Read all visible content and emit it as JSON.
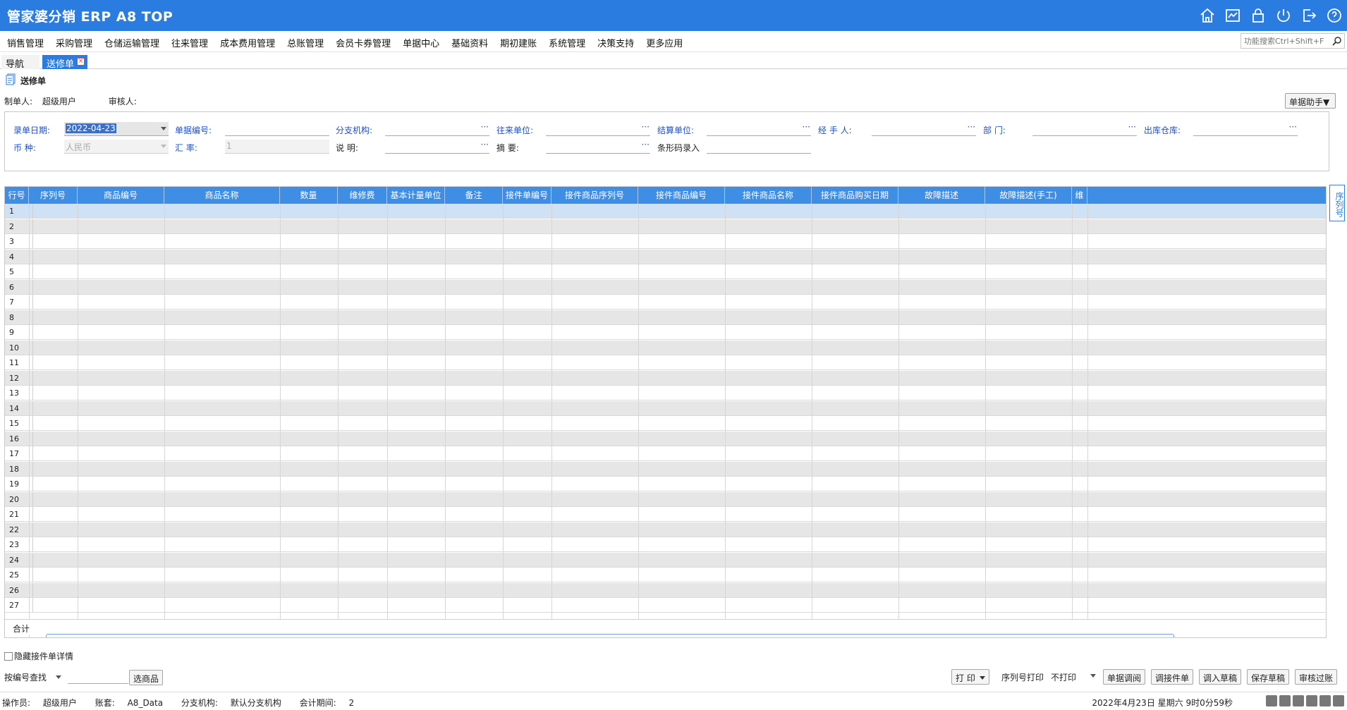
{
  "app": {
    "title": "管家婆分销 ERP A8 TOP"
  },
  "titlebar_icons": [
    "home-icon",
    "chart-icon",
    "lock-icon",
    "power-icon",
    "exit-icon",
    "help-icon"
  ],
  "menu": {
    "items": [
      "销售管理",
      "采购管理",
      "仓储运输管理",
      "往来管理",
      "成本费用管理",
      "总账管理",
      "会员卡券管理",
      "单据中心",
      "基础资料",
      "期初建账",
      "系统管理",
      "决策支持",
      "更多应用"
    ],
    "search_placeholder": "功能搜索Ctrl+Shift+F"
  },
  "tabs": {
    "nav": "导航",
    "active": "送修单"
  },
  "page": {
    "title": "送修单",
    "maker_label": "制单人:",
    "maker_value": "超级用户",
    "reviewer_label": "审核人:",
    "helper_button": "单据助手▼"
  },
  "form": {
    "date_label": "录单日期:",
    "date_value": "2022-04-23",
    "docno_label": "单据编号:",
    "branch_label": "分支机构:",
    "partner_label": "往来单位:",
    "settle_label": "结算单位:",
    "handler_label": "经 手 人:",
    "dept_label": "部    门:",
    "warehouse_label": "出库仓库:",
    "currency_label": "币    种:",
    "currency_value": "人民币",
    "rate_label": "汇    率:",
    "rate_value": "1",
    "note_label": "说    明:",
    "summary_label": "摘    要:",
    "barcode_label": "条形码录入"
  },
  "grid": {
    "columns": [
      "行号",
      "序列号",
      "商品编号",
      "商品名称",
      "数量",
      "维修费",
      "基本计量单位",
      "备注",
      "接件单编号",
      "接件商品序列号",
      "接件商品编号",
      "接件商品名称",
      "接件商品购买日期",
      "故障描述",
      "故障描述(手工)",
      "维"
    ],
    "rows": [
      "1",
      "2",
      "3",
      "4",
      "5",
      "6",
      "7",
      "8",
      "9",
      "10",
      "11",
      "12",
      "13",
      "14",
      "15",
      "16",
      "17",
      "18",
      "19",
      "20",
      "21",
      "22",
      "23",
      "24",
      "25",
      "26",
      "27"
    ],
    "sum_label": "合计",
    "side_tab": "序列号"
  },
  "bottom": {
    "hide_detail": "隐藏接件单详情",
    "search_mode": "按编号查找",
    "select_goods": "选商品",
    "print": "打 印",
    "serial_print_label": "序列号打印",
    "serial_print_value": "不打印",
    "btn_doc_call": "单据调阅",
    "btn_call_receive": "调接件单",
    "btn_load_draft": "调入草稿",
    "btn_save_draft": "保存草稿",
    "btn_review": "审核过账"
  },
  "status": {
    "operator_label": "操作员:",
    "operator_value": "超级用户",
    "account_label": "账套:",
    "account_value": "A8_Data",
    "branch_label": "分支机构:",
    "branch_value": "默认分支机构",
    "period_label": "会计期间:",
    "period_value": "2",
    "datetime": "2022年4月23日  星期六  9时0分59秒"
  },
  "colors": {
    "brand": "#2b7ce0",
    "grid_header": "#3f8ee6",
    "label_blue": "#1a4fd0"
  }
}
